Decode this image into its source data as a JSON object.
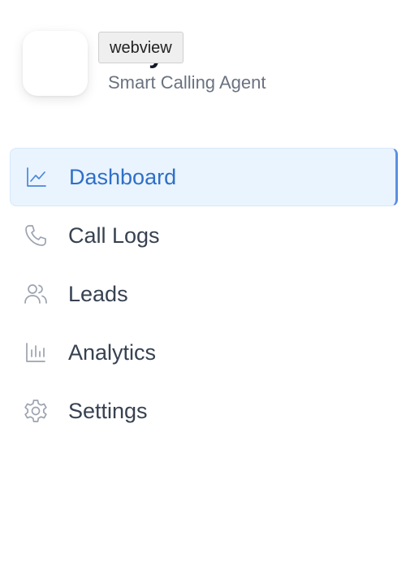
{
  "header": {
    "app_name": "BRyt",
    "subtitle": "Smart Calling Agent",
    "tooltip": "webview"
  },
  "sidebar": {
    "items": [
      {
        "label": "Dashboard",
        "icon": "line-chart-icon",
        "active": true
      },
      {
        "label": "Call Logs",
        "icon": "phone-icon",
        "active": false
      },
      {
        "label": "Leads",
        "icon": "users-icon",
        "active": false
      },
      {
        "label": "Analytics",
        "icon": "bar-chart-icon",
        "active": false
      },
      {
        "label": "Settings",
        "icon": "gear-icon",
        "active": false
      }
    ]
  },
  "colors": {
    "accent": "#2f6fc7",
    "active_bg": "#eaf4fe",
    "text": "#374151",
    "muted": "#6b7280",
    "icon_inactive": "#9ca3af"
  }
}
